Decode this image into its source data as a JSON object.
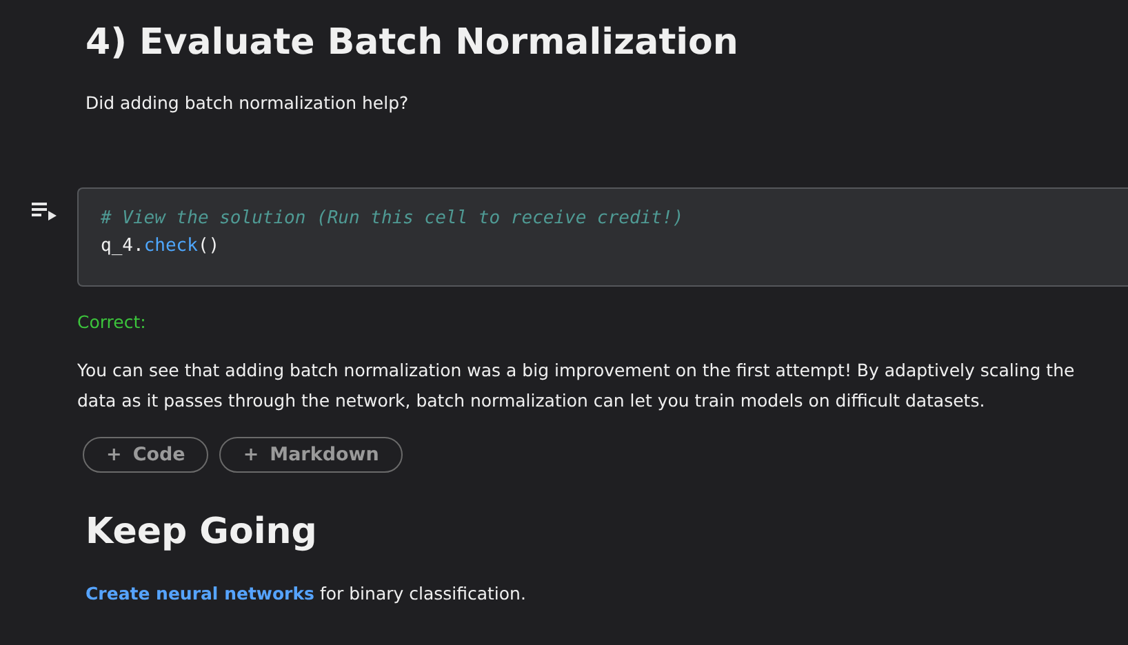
{
  "heading": "4) Evaluate Batch Normalization",
  "question": "Did adding batch normalization help?",
  "code_cell": {
    "comment": "# View the solution (Run this cell to receive credit!)",
    "object": "q_4.",
    "method": "check",
    "parens": "()"
  },
  "output": {
    "status": "Correct:",
    "text": "You can see that adding batch normalization was a big improvement on the first attempt! By adaptively scaling the data as it passes through the network, batch normalization can let you train models on difficult datasets."
  },
  "add_buttons": [
    {
      "icon": "+",
      "label": "Code"
    },
    {
      "icon": "+",
      "label": "Markdown"
    }
  ],
  "next_heading": "Keep Going",
  "next": {
    "link": "Create neural networks",
    "text": " for binary classification."
  }
}
